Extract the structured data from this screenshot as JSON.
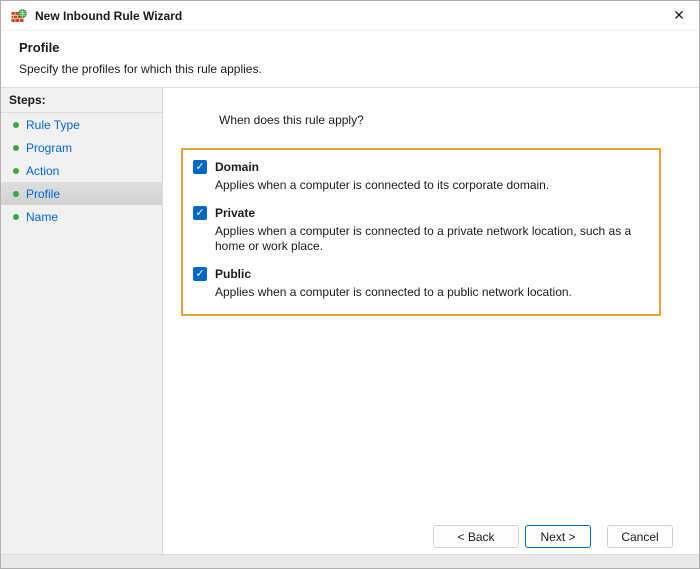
{
  "window": {
    "title": "New Inbound Rule Wizard"
  },
  "icons": {
    "close": "✕",
    "check": "✓"
  },
  "header": {
    "title": "Profile",
    "subtitle": "Specify the profiles for which this rule applies."
  },
  "sidebar": {
    "heading": "Steps:",
    "items": [
      {
        "label": "Rule Type",
        "active": false
      },
      {
        "label": "Program",
        "active": false
      },
      {
        "label": "Action",
        "active": false
      },
      {
        "label": "Profile",
        "active": true
      },
      {
        "label": "Name",
        "active": false
      }
    ]
  },
  "main": {
    "question": "When does this rule apply?",
    "profiles": [
      {
        "label": "Domain",
        "checked": true,
        "description": "Applies when a computer is connected to its corporate domain."
      },
      {
        "label": "Private",
        "checked": true,
        "description": "Applies when a computer is connected to a private network location, such as a home or work place."
      },
      {
        "label": "Public",
        "checked": true,
        "description": "Applies when a computer is connected to a public network location."
      }
    ]
  },
  "footer": {
    "back_label": "< Back",
    "next_label": "Next >",
    "cancel_label": "Cancel"
  },
  "colors": {
    "step_link_blue": "#0066cc",
    "step_bullet_green": "#39a845",
    "checkbox_blue": "#0067c0",
    "annotation_orange": "#e2a33c",
    "sidebar_gray": "#f1f1f1",
    "active_step_gray": "#d2d2d2"
  }
}
